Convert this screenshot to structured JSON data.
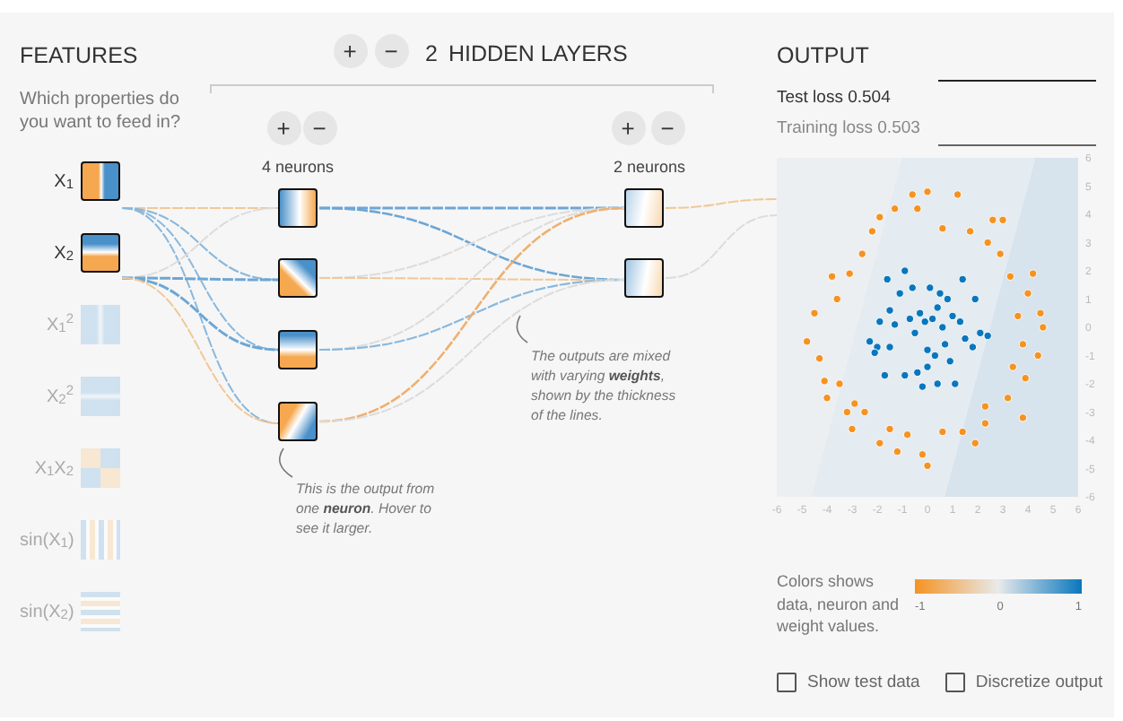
{
  "features": {
    "title": "FEATURES",
    "subtitle": "Which properties do you want to feed in?",
    "items": [
      {
        "label": "X$_{1}$",
        "selected": true
      },
      {
        "label": "X$_{2}$",
        "selected": true
      },
      {
        "label": "X$_{1}$$^{2}$",
        "selected": false
      },
      {
        "label": "X$_{2}$$^{2}$",
        "selected": false
      },
      {
        "label": "X$_{1}$X$_{2}$",
        "selected": false
      },
      {
        "label": "sin(X$_{1}$)",
        "selected": false
      },
      {
        "label": "sin(X$_{2}$)",
        "selected": false
      }
    ]
  },
  "network": {
    "add_button": "+",
    "remove_button": "−",
    "layer_count": "2",
    "layer_label": "HIDDEN LAYERS",
    "layers": [
      {
        "add_button": "+",
        "remove_button": "−",
        "neurons_label": "4 neurons"
      },
      {
        "add_button": "+",
        "remove_button": "−",
        "neurons_label": "2 neurons"
      }
    ],
    "annotations": [
      "This is the output from one **neuron**. Hover to see it larger.",
      "The outputs are mixed with varying **weights**, shown by the thickness of the lines."
    ]
  },
  "output": {
    "title": "OUTPUT",
    "test_loss": "Test loss 0.504",
    "training_loss": "Training loss 0.503",
    "chart_data": {
      "type": "scatter",
      "xlim": [
        -6,
        6
      ],
      "ylim": [
        -6,
        6
      ],
      "xticks": [
        {
          "value": -6,
          "label": "-6"
        },
        {
          "value": -5,
          "label": "-5"
        },
        {
          "value": -4,
          "label": "-4"
        },
        {
          "value": -3,
          "label": "-3"
        },
        {
          "value": -2,
          "label": "-2"
        },
        {
          "value": -1,
          "label": "-1"
        },
        {
          "value": 0,
          "label": "0"
        },
        {
          "value": 1,
          "label": "1"
        },
        {
          "value": 2,
          "label": "2"
        },
        {
          "value": 3,
          "label": "3"
        },
        {
          "value": 4,
          "label": "4"
        },
        {
          "value": 5,
          "label": "5"
        },
        {
          "value": 6,
          "label": "6"
        }
      ],
      "yticks": [
        {
          "value": -6,
          "label": "-6"
        },
        {
          "value": -5,
          "label": "-5"
        },
        {
          "value": -4,
          "label": "-4"
        },
        {
          "value": -3,
          "label": "-3"
        },
        {
          "value": -2,
          "label": "-2"
        },
        {
          "value": -1,
          "label": "-1"
        },
        {
          "value": 0,
          "label": "0"
        },
        {
          "value": 1,
          "label": "1"
        },
        {
          "value": 2,
          "label": "2"
        },
        {
          "value": 3,
          "label": "3"
        },
        {
          "value": 4,
          "label": "4"
        },
        {
          "value": 5,
          "label": "5"
        },
        {
          "value": 6,
          "label": "6"
        }
      ],
      "series": [
        {
          "color": "#f59322",
          "x": [
            -4.8,
            -4.5,
            -4.3,
            -4.1,
            -4.0,
            -3.8,
            -3.6,
            -3.5,
            -3.2,
            -3.1,
            -3.0,
            -2.6,
            -2.5,
            -2.2,
            -1.9,
            -1.9,
            -1.5,
            -1.3,
            -1.2,
            -0.8,
            -0.6,
            -0.4,
            -0.2,
            0,
            0,
            0.6,
            0.6,
            1.2,
            1.4,
            1.7,
            1.9,
            2.3,
            2.3,
            2.4,
            2.6,
            2.9,
            3.0,
            3.3,
            3.2,
            3.4,
            3.6,
            3.8,
            3.9,
            4.0,
            4.2,
            4.5,
            4.6,
            4.4,
            3.8,
            -2.9
          ],
          "values": [
            -0.5,
            0.5,
            -1.1,
            -1.9,
            -2.5,
            1.8,
            1.0,
            -2.0,
            -3.0,
            1.9,
            -3.6,
            2.6,
            -3.0,
            3.4,
            3.9,
            -4.1,
            -3.6,
            4.2,
            -4.4,
            -3.8,
            4.7,
            4.2,
            -4.5,
            4.8,
            -4.9,
            3.5,
            -3.7,
            4.7,
            -3.7,
            3.4,
            -4.1,
            -2.8,
            -3.4,
            3.0,
            3.8,
            2.6,
            3.8,
            1.8,
            -2.5,
            -1.4,
            0.4,
            -0.6,
            -1.8,
            1.2,
            1.9,
            0.5,
            0,
            -1.0,
            -3.2,
            -2.7
          ]
        },
        {
          "color": "#0877bd",
          "x": [
            -2.3,
            -2.0,
            -1.9,
            -1.7,
            -1.6,
            -1.5,
            -1.5,
            -1.3,
            -1.1,
            -0.9,
            -0.9,
            -0.7,
            -0.6,
            -0.5,
            -0.4,
            -0.3,
            -0.2,
            -0.1,
            0,
            0.1,
            0.2,
            0.3,
            0.4,
            0.4,
            0.5,
            0.6,
            0.7,
            0.8,
            0.9,
            1.0,
            1.1,
            1.3,
            1.4,
            1.5,
            1.8,
            1.9,
            2.1,
            2.4,
            -2.1,
            0
          ],
          "values": [
            -0.5,
            -0.7,
            0.2,
            -1.7,
            1.7,
            -0.7,
            0.6,
            0.1,
            1.2,
            2.0,
            -1.7,
            0.3,
            1.4,
            -0.2,
            -1.6,
            0.5,
            -2.1,
            0.2,
            -0.8,
            1.4,
            0.3,
            -1.0,
            0.7,
            -2.0,
            1.2,
            0,
            -0.6,
            1.0,
            -1.2,
            0.4,
            -2.0,
            0.2,
            1.7,
            -0.4,
            -0.7,
            1.0,
            -0.2,
            -0.3,
            -0.9,
            -1.4
          ]
        }
      ]
    },
    "legend_text": "Colors shows data, neuron and weight values.",
    "legend_min": "-1",
    "legend_mid": "0",
    "legend_max": "1",
    "checkboxes": [
      {
        "label": "Show test data",
        "checked": false
      },
      {
        "label": "Discretize output",
        "checked": false
      }
    ]
  }
}
